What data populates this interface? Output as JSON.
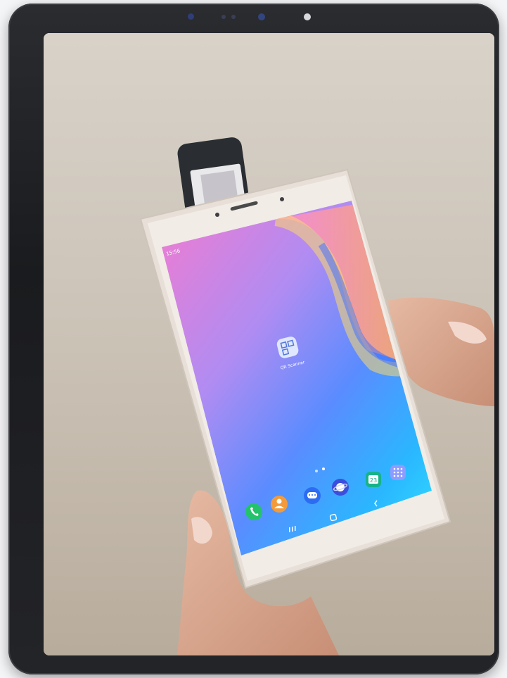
{
  "device": {
    "status_time": "15:56",
    "app_icon_label": "QR Scanner",
    "calendar_day": "23"
  },
  "colors": {
    "frame": "#1e1f22",
    "wall": "#cfc7bc",
    "tablet_body": "#efe9e2",
    "wallpaper_pink": "#ee6fd2",
    "wallpaper_blue": "#2d7bff",
    "wallpaper_cyan": "#25d6ff"
  }
}
